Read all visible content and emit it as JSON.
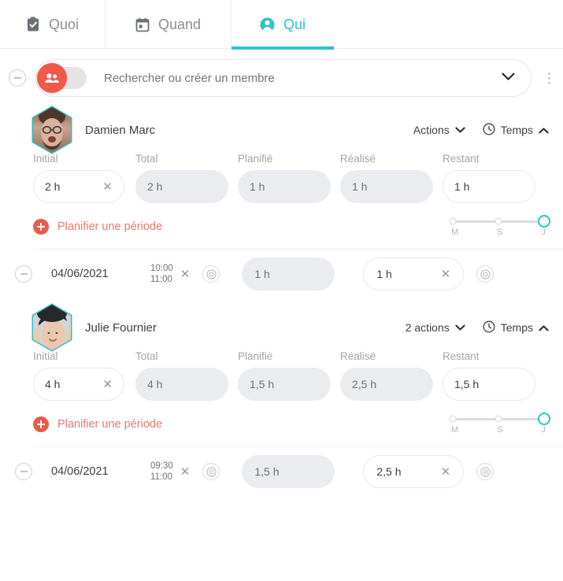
{
  "tabs": [
    {
      "label": "Quoi",
      "icon": "clipboard-check-icon",
      "active": false
    },
    {
      "label": "Quand",
      "icon": "calendar-icon",
      "active": false
    },
    {
      "label": "Qui",
      "icon": "person-icon",
      "active": true
    }
  ],
  "search": {
    "placeholder": "Rechercher ou créer un membre",
    "value": "",
    "toggle_icon": "group-icon",
    "chevron_icon": "chevron-down-icon",
    "remove_icon": "minus-circle-icon",
    "overflow_icon": "kebab-menu-icon"
  },
  "colors": {
    "accent_teal": "#2ec4c9",
    "accent_red": "#ea5a4a",
    "link_red": "#e8796c",
    "field_grey": "#ebecef",
    "text": "#3c4043",
    "muted": "#a4a4a4"
  },
  "column_headers": [
    "Initial",
    "Total",
    "Planifié",
    "Réalisé",
    "Restant"
  ],
  "plan_link_label": "Planifier une période",
  "slider": {
    "stops": [
      "M",
      "S",
      "J"
    ],
    "selected": "J"
  },
  "clock_label": "Temps",
  "members": [
    {
      "name": "Damien Marc",
      "avatar": "avatar-damien",
      "actions_label": "Actions",
      "time_label": "Temps",
      "values": {
        "initial": "2 h",
        "total": "2 h",
        "planifie": "1 h",
        "realise": "1 h",
        "restant": "1 h"
      },
      "periods": [
        {
          "date": "04/06/2021",
          "start_time": "10:00",
          "end_time": "11:00",
          "planifie": "1 h",
          "realise": "1 h"
        }
      ]
    },
    {
      "name": "Julie Fournier",
      "avatar": "avatar-julie",
      "actions_label": "2 actions",
      "time_label": "Temps",
      "values": {
        "initial": "4 h",
        "total": "4 h",
        "planifie": "1,5 h",
        "realise": "2,5 h",
        "restant": "1,5 h"
      },
      "periods": [
        {
          "date": "04/06/2021",
          "start_time": "09:30",
          "end_time": "11:00",
          "planifie": "1,5 h",
          "realise": "2,5 h"
        }
      ]
    }
  ]
}
